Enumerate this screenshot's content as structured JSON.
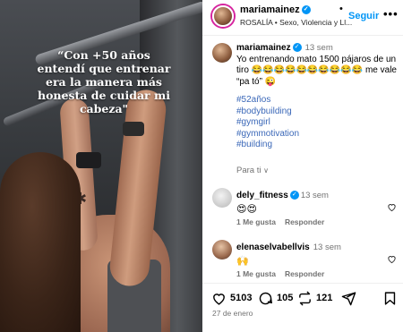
{
  "media": {
    "caption": "“Con +50 años entendí que entrenar era la manera más honesta de cuidar mi cabeza\""
  },
  "header": {
    "username": "mariamainez",
    "follow_label": "Seguir",
    "separator": "•",
    "music": "ROSALÍA • Sexo, Violencia y Ll...",
    "more_label": "•••"
  },
  "post": {
    "username": "mariamainez",
    "time": "13 sem",
    "caption": "Yo entrenando mato 1500 pájaros de un tiro 😂😂😂😂😂😂😂😂😂😂 me vale “pa tó” 😜",
    "hashtags": [
      "#52años",
      "#bodybuilding",
      "#gymgirl",
      "#gymmotivation",
      "#building"
    ],
    "translate_label": "Para ti",
    "translate_chevron": "∨"
  },
  "comments": [
    {
      "username": "dely_fitness",
      "verified": true,
      "time": "13 sem",
      "text": "😍😍",
      "likes_label": "1 Me gusta",
      "reply_label": "Responder"
    },
    {
      "username": "elenaselvabellvis",
      "verified": false,
      "time": "13 sem",
      "text": "🙌",
      "likes_label": "1 Me gusta",
      "reply_label": "Responder"
    }
  ],
  "actions": {
    "likes": "5103",
    "comments": "105",
    "reposts": "121"
  },
  "date": "27 de enero",
  "colors": {
    "accent_blue": "#0095f6",
    "hashtag_blue": "#3b68b8",
    "muted_gray": "#737373",
    "story_ring": "#d6249f"
  },
  "icons": [
    "heart-icon",
    "comment-icon",
    "repost-icon",
    "share-icon",
    "save-icon",
    "verified-icon",
    "more-icon"
  ]
}
